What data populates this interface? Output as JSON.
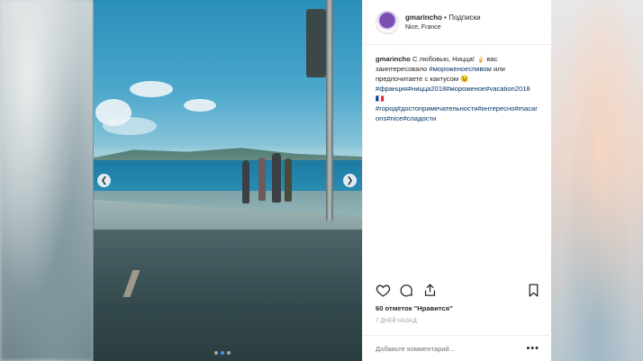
{
  "post": {
    "username": "gmarincho",
    "separator": "•",
    "follow_label": "Подписки",
    "location": "Nice, France",
    "caption_author": "gmarincho",
    "caption_text": "С любовью, Ницца! 🍦 вас заинтересовало",
    "caption_hashtag_1": "#мороженоеспивом",
    "caption_text_2": "или предпочитаете с кактусом 😉",
    "caption_hashtags_line_1": "#франция#ницца2018#мороженое#vacation2018🇫🇷",
    "caption_hashtags_line_2": "#город#достопримечательности#интересно#macarons#nice#сладости",
    "likes": "60 отметок \"Нравится\"",
    "time": "7 ДНЕЙ НАЗАД",
    "comment_placeholder": "Добавьте комментарий...",
    "more_icon_label": "•••"
  },
  "carousel": {
    "prev_glyph": "❮",
    "next_glyph": "❯",
    "slide_count": 3,
    "active_index": 1
  },
  "icons": {
    "like": "heart-icon",
    "comment": "comment-icon",
    "share": "share-icon",
    "save": "bookmark-icon"
  },
  "colors": {
    "link": "#003569",
    "accent": "#3897f0",
    "text": "#262626",
    "muted": "#999999"
  }
}
